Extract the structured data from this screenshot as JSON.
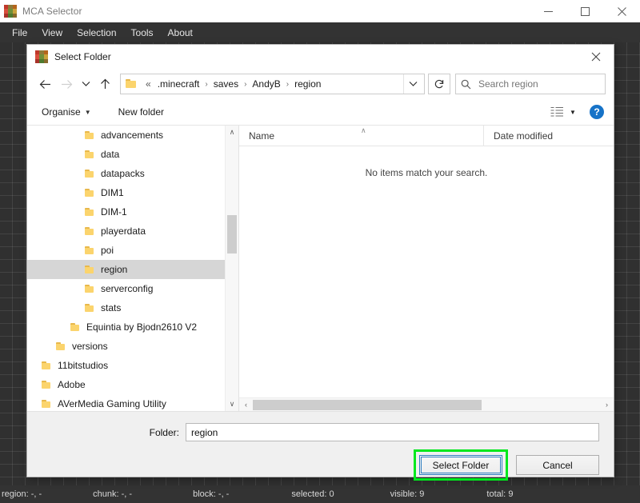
{
  "app": {
    "title": "MCA Selector",
    "icon": "mca-selector-icon",
    "window_buttons": [
      {
        "name": "minimize-button",
        "glyph": "minimize"
      },
      {
        "name": "maximize-button",
        "glyph": "maximize"
      },
      {
        "name": "close-button",
        "glyph": "close"
      }
    ],
    "menu": [
      "File",
      "View",
      "Selection",
      "Tools",
      "About"
    ],
    "statusbar": [
      {
        "label": "region:",
        "value": "-, -"
      },
      {
        "label": "chunk:",
        "value": "-, -"
      },
      {
        "label": "block:",
        "value": "-, -"
      },
      {
        "label": "selected:",
        "value": "0"
      },
      {
        "label": "visible:",
        "value": "9"
      },
      {
        "label": "total:",
        "value": "9"
      }
    ]
  },
  "dialog": {
    "title": "Select Folder",
    "close_label": "✕",
    "nav": {
      "back": "←",
      "forward": "→",
      "recent": "⌄",
      "up": "↑",
      "overflow": "«",
      "breadcrumbs": [
        ".minecraft",
        "saves",
        "AndyB",
        "region"
      ],
      "separator": "›",
      "dropdown": "⌄",
      "refresh": "↻"
    },
    "search": {
      "placeholder": "Search region",
      "icon": "search-icon"
    },
    "toolbar": {
      "organise": "Organise",
      "organise_caret": "▼",
      "new_folder": "New folder",
      "view_caret": "▼",
      "help": "?"
    },
    "tree": {
      "items": [
        {
          "label": "advancements",
          "indent": 3,
          "selected": false
        },
        {
          "label": "data",
          "indent": 3,
          "selected": false
        },
        {
          "label": "datapacks",
          "indent": 3,
          "selected": false
        },
        {
          "label": "DIM1",
          "indent": 3,
          "selected": false
        },
        {
          "label": "DIM-1",
          "indent": 3,
          "selected": false
        },
        {
          "label": "playerdata",
          "indent": 3,
          "selected": false
        },
        {
          "label": "poi",
          "indent": 3,
          "selected": false
        },
        {
          "label": "region",
          "indent": 3,
          "selected": true
        },
        {
          "label": "serverconfig",
          "indent": 3,
          "selected": false
        },
        {
          "label": "stats",
          "indent": 3,
          "selected": false
        },
        {
          "label": "Equintia by Bjodn2610 V2",
          "indent": 2,
          "selected": false
        },
        {
          "label": "versions",
          "indent": 1,
          "selected": false
        },
        {
          "label": "11bitstudios",
          "indent": 0,
          "selected": false
        },
        {
          "label": "Adobe",
          "indent": 0,
          "selected": false
        },
        {
          "label": "AVerMedia Gaming Utility",
          "indent": 0,
          "selected": false
        }
      ],
      "scroll_up": "∧",
      "scroll_down": "∨"
    },
    "list": {
      "columns": [
        "Name",
        "Date modified"
      ],
      "sort_caret": "∧",
      "empty_message": "No items match your search.",
      "scroll_left": "‹",
      "scroll_right": "›"
    },
    "footer": {
      "folder_label": "Folder:",
      "folder_value": "region",
      "select_button": "Select Folder",
      "cancel_button": "Cancel"
    }
  },
  "colors": {
    "highlight_ring": "#00e81e",
    "focus_border": "#2f7ec0",
    "menu_bg": "#333333",
    "canvas_bg": "#303030",
    "help_blue": "#1673c8"
  }
}
